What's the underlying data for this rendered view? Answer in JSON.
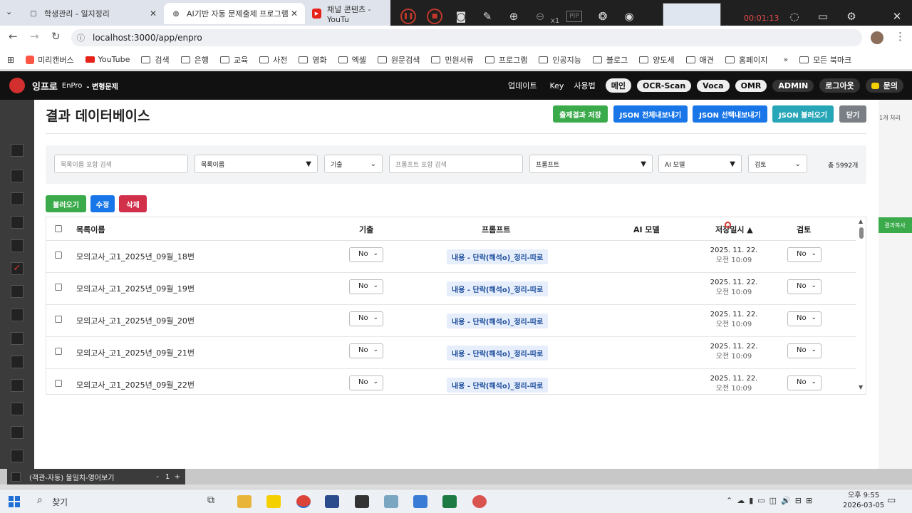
{
  "browser": {
    "tabs": [
      {
        "title": "학생관리 - 일지정리",
        "active": false
      },
      {
        "title": "AI기반 자동 문제출제 프로그램",
        "active": true
      },
      {
        "title": "채널 콘텐츠 - YouTu",
        "active": false
      }
    ],
    "url": "localhost:3000/app/enpro",
    "bookmarks": [
      "미리캔버스",
      "YouTube",
      "검색",
      "은행",
      "교육",
      "사전",
      "영화",
      "엑셀",
      "원문검색",
      "민원서류",
      "프로그램",
      "인공지능",
      "블로그",
      "양도세",
      "애견",
      "홈페이지"
    ],
    "bookmarks_right": "모든 북마크",
    "recorder_time": "00:01:13",
    "recorder_zoom": "x1"
  },
  "app": {
    "logo": "잉프로",
    "logo_sub": "EnPro",
    "section": "- 변형문제",
    "nav_links": [
      "업데이트",
      "Key",
      "사용법"
    ],
    "nav_pills": [
      "메인",
      "OCR-Scan",
      "Voca",
      "OMR",
      "ADMIN",
      "로그아웃"
    ],
    "inquiry": "문의",
    "bg_right_text": "1개 처리",
    "bg_right_btn": "결과복사",
    "bg_bottom_label": "(객관-자동) 불일치-영어보기",
    "bg_bottom_minus": "-",
    "bg_bottom_count": "1",
    "bg_bottom_plus": "+"
  },
  "modal": {
    "title": "결과 데이터베이스",
    "buttons": {
      "save": "출제결과 저장",
      "export_all": "JSON 전체내보내기",
      "export_sel": "JSON 선택내보내기",
      "import": "JSON 불러오기",
      "close": "닫기"
    },
    "filters": {
      "name_search_placeholder": "목록이름 포함 검색",
      "name_select": "목록이름",
      "past_select": "기출",
      "prompt_search_placeholder": "프롬프트 포함 검색",
      "prompt_select": "프롬프트",
      "model_select": "AI 모델",
      "review_select": "검토",
      "total": "총 5992개"
    },
    "actions": {
      "load": "불러오기",
      "edit": "수정",
      "delete": "삭제"
    },
    "columns": {
      "name": "목록이름",
      "past": "기출",
      "prompt": "프롬프트",
      "model": "AI 모델",
      "saved": "저장일시 ▲",
      "review": "검토"
    },
    "rows": [
      {
        "name": "모의고사_고1_2025년_09월_18번",
        "past": "No",
        "prompt": "내용 - 단락(해석o)_정리-따로",
        "model": "",
        "date": "2025. 11. 22.",
        "time": "오전 10:09",
        "review": "No"
      },
      {
        "name": "모의고사_고1_2025년_09월_19번",
        "past": "No",
        "prompt": "내용 - 단락(해석o)_정리-따로",
        "model": "",
        "date": "2025. 11. 22.",
        "time": "오전 10:09",
        "review": "No"
      },
      {
        "name": "모의고사_고1_2025년_09월_20번",
        "past": "No",
        "prompt": "내용 - 단락(해석o)_정리-따로",
        "model": "",
        "date": "2025. 11. 22.",
        "time": "오전 10:09",
        "review": "No"
      },
      {
        "name": "모의고사_고1_2025년_09월_21번",
        "past": "No",
        "prompt": "내용 - 단락(해석o)_정리-따로",
        "model": "",
        "date": "2025. 11. 22.",
        "time": "오전 10:09",
        "review": "No"
      },
      {
        "name": "모의고사_고1_2025년_09월_22번",
        "past": "No",
        "prompt": "내용 - 단락(해석o)_정리-따로",
        "model": "",
        "date": "2025. 11. 22.",
        "time": "오전 10:09",
        "review": "No"
      }
    ]
  },
  "taskbar": {
    "search": "찾기",
    "time": "오후 9:55",
    "date": "2026-03-05"
  },
  "colors": {
    "green": "#3aaa4a",
    "blue": "#1976e8",
    "red": "#d12f4a",
    "teal": "#27a6b8",
    "gray": "#7a7f85"
  }
}
